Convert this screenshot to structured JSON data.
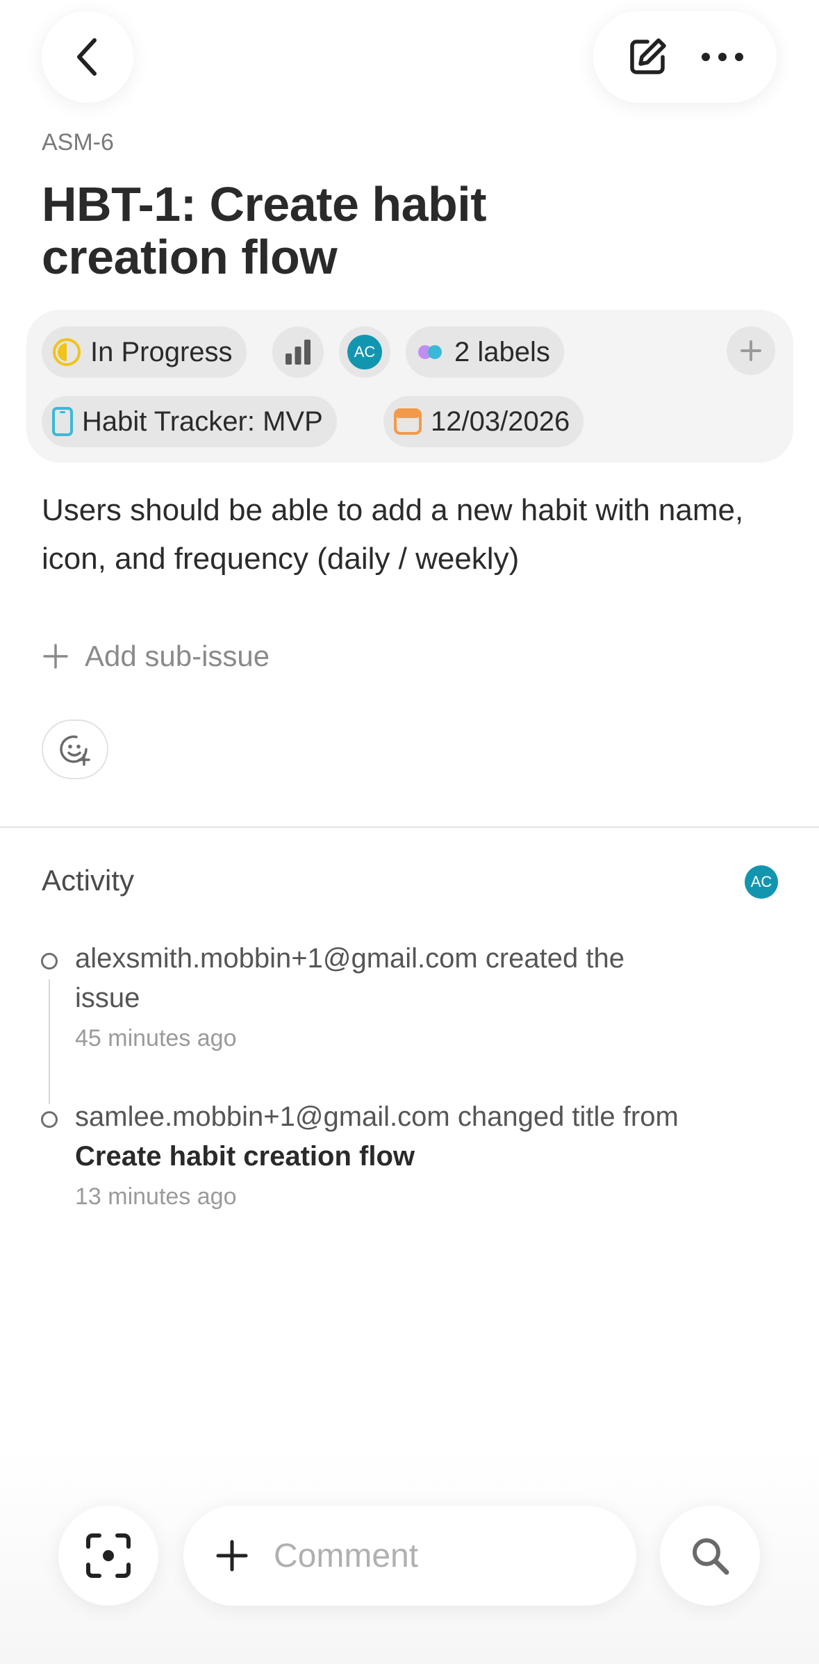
{
  "header": {
    "issue_id": "ASM-6",
    "title": "HBT-1: Create habit creation flow"
  },
  "properties": {
    "status": "In Progress",
    "assignee_initials": "AC",
    "labels": "2 labels",
    "project": "Habit Tracker: MVP",
    "due_date": "12/03/2026"
  },
  "description": "Users should be able to add a new habit with name, icon, and frequency (daily / weekly)",
  "add_sub_issue": "Add sub-issue",
  "activity": {
    "title": "Activity",
    "avatar_initials": "AC",
    "items": [
      {
        "text": "alexsmith.mobbin+1@gmail.com created the issue",
        "time": "45 minutes ago"
      },
      {
        "text": "samlee.mobbin+1@gmail.com changed title from",
        "strong": "Create habit creation flow",
        "time": "13 minutes ago"
      }
    ]
  },
  "bottom_bar": {
    "comment_placeholder": "Comment"
  },
  "colors": {
    "status_yellow": "#f0c419",
    "avatar_teal": "#1296b0",
    "project_blue": "#3bb8d8",
    "date_orange": "#f29a4a",
    "label_purple": "#c08ef0"
  }
}
